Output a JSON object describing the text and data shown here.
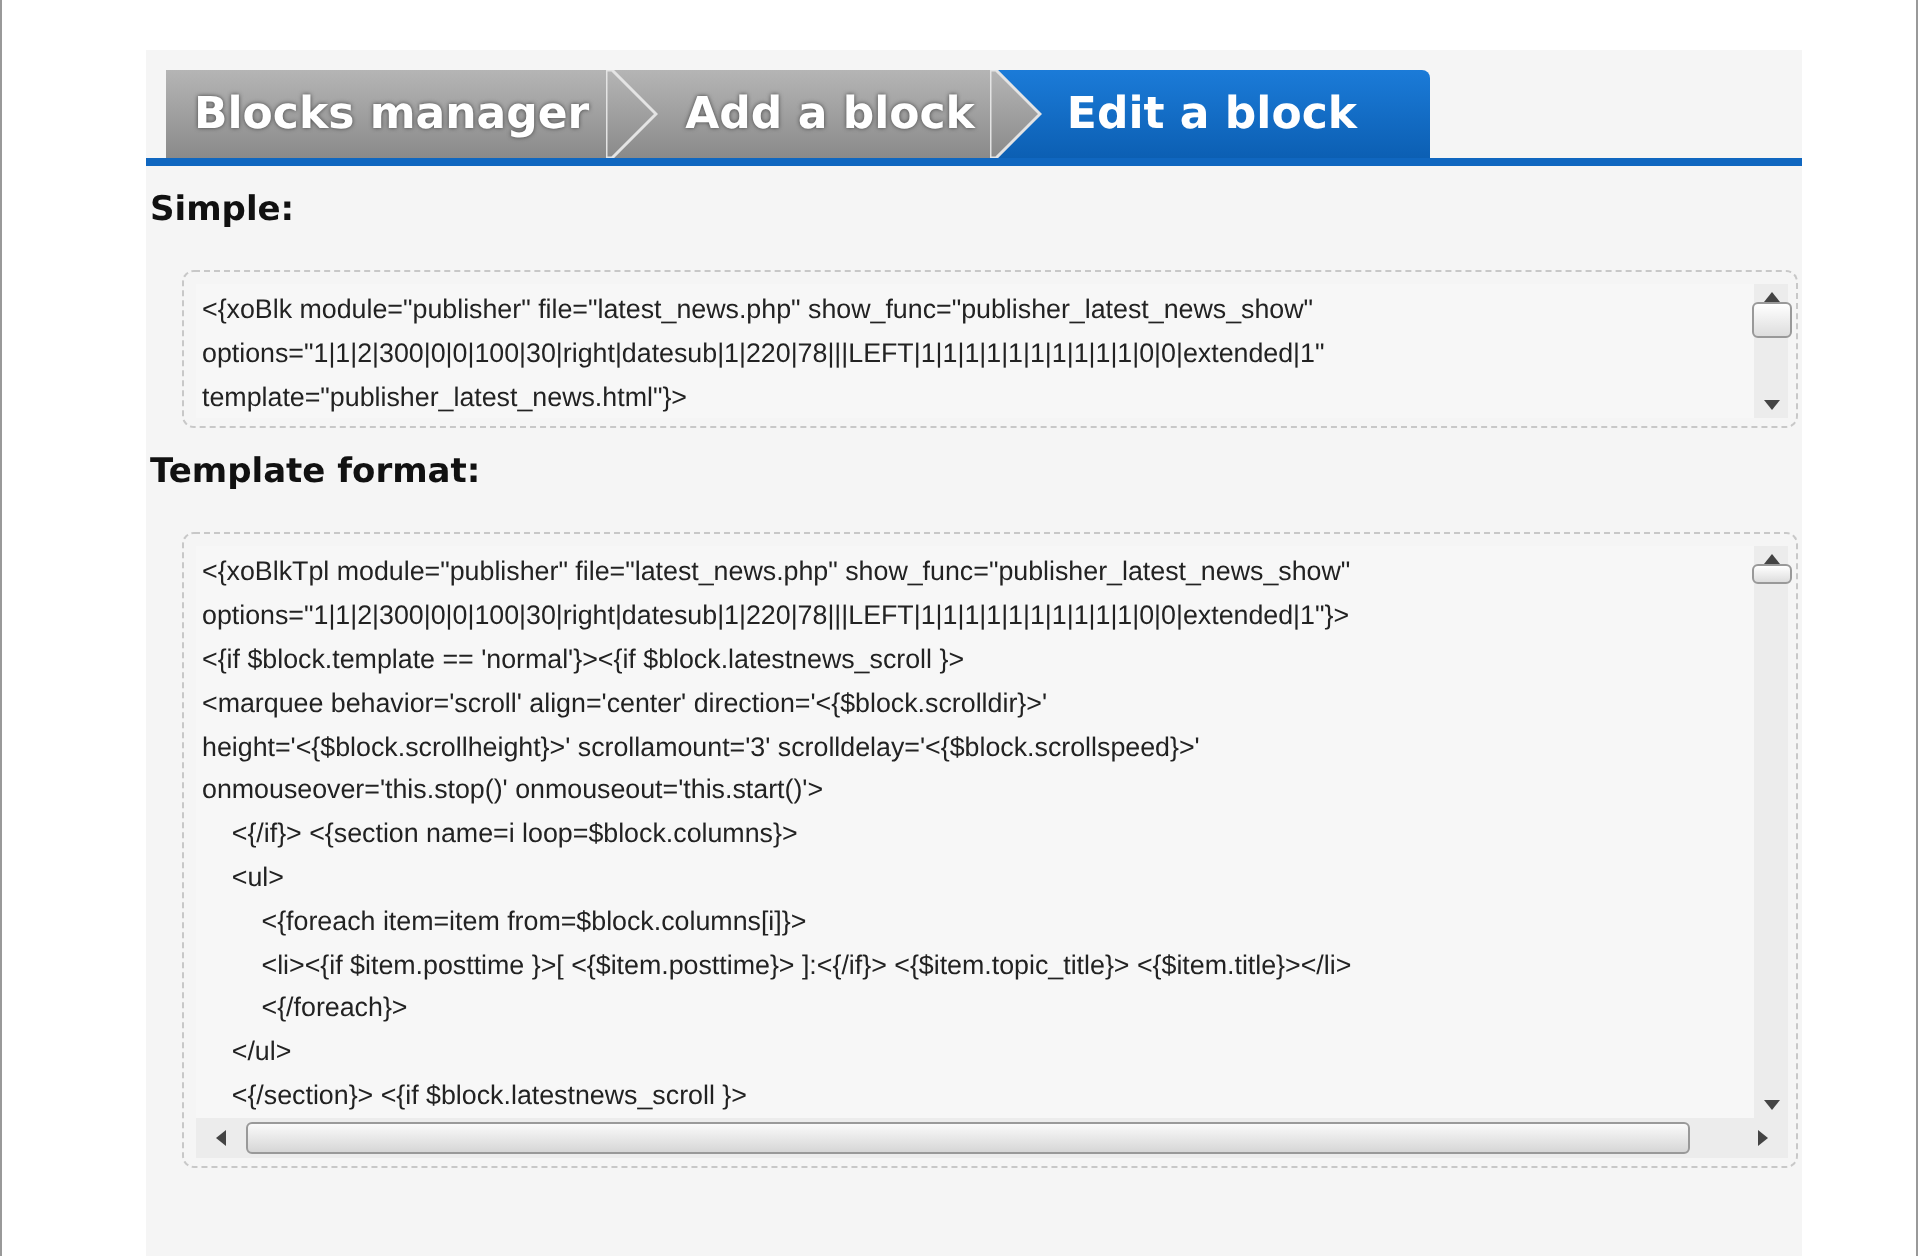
{
  "tabs": [
    {
      "label": "Blocks manager",
      "selected": false
    },
    {
      "label": "Add a block",
      "selected": false
    },
    {
      "label": "Edit a block",
      "selected": true
    }
  ],
  "sections": [
    {
      "heading": "Simple:",
      "horizontal_scrollbar": false,
      "lines": [
        "<{xoBlk module=\"publisher\" file=\"latest_news.php\" show_func=\"publisher_latest_news_show\"",
        "options=\"1|1|2|300|0|0|100|30|right|datesub|1|220|78|||LEFT|1|1|1|1|1|1|1|1|1|1|0|0|extended|1\"",
        "template=\"publisher_latest_news.html\"}>"
      ]
    },
    {
      "heading": "Template format:",
      "horizontal_scrollbar": true,
      "lines": [
        "<{xoBlkTpl module=\"publisher\" file=\"latest_news.php\" show_func=\"publisher_latest_news_show\"",
        "options=\"1|1|2|300|0|0|100|30|right|datesub|1|220|78|||LEFT|1|1|1|1|1|1|1|1|1|1|0|0|extended|1\"}>",
        "<{if $block.template == 'normal'}><{if $block.latestnews_scroll }>",
        "<marquee behavior='scroll' align='center' direction='<{$block.scrolldir}>'",
        "height='<{$block.scrollheight}>' scrollamount='3' scrolldelay='<{$block.scrollspeed}>'",
        "onmouseover='this.stop()' onmouseout='this.start()'>",
        "    <{/if}> <{section name=i loop=$block.columns}>",
        "    <ul>",
        "        <{foreach item=item from=$block.columns[i]}>",
        "        <li><{if $item.posttime }>[ <{$item.posttime}> ]:<{/if}> <{$item.topic_title}> <{$item.title}></li>",
        "        <{/foreach}>",
        "    </ul>",
        "    <{/section}> <{if $block.latestnews_scroll }>"
      ]
    }
  ]
}
